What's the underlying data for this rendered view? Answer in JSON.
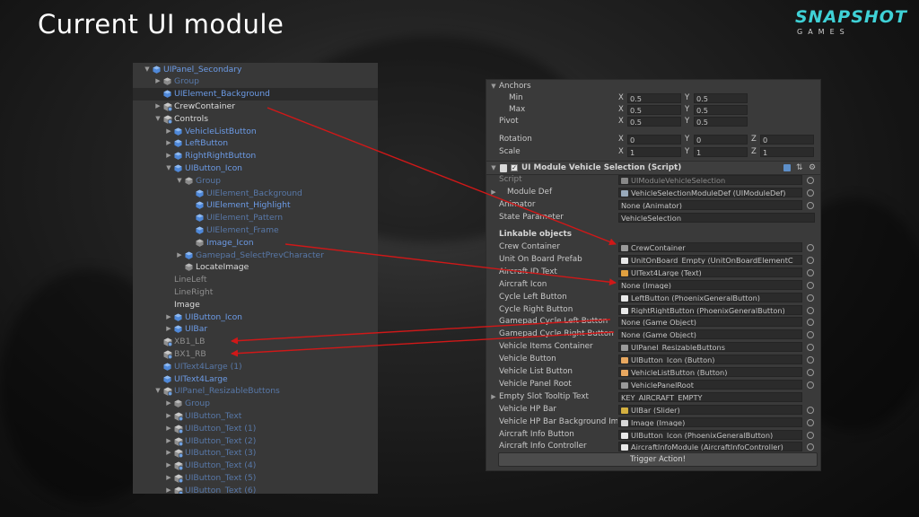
{
  "slide": {
    "title": "Current UI module",
    "logo": {
      "brand": "SNAPSHOT",
      "sub": "GAMES"
    }
  },
  "hierarchy": {
    "rows": [
      {
        "label": "UIPanel_Secondary",
        "indent": 0,
        "arrow": "open",
        "icon": "cube",
        "color": "blue"
      },
      {
        "label": "Group",
        "indent": 1,
        "arrow": "closed",
        "icon": "cube-grey",
        "color": "dimblue"
      },
      {
        "label": "UIElement_Background",
        "indent": 1,
        "arrow": "none",
        "icon": "cube",
        "color": "blue",
        "selected": true
      },
      {
        "label": "CrewContainer",
        "indent": 1,
        "arrow": "closed",
        "icon": "cube-gear",
        "color": "white"
      },
      {
        "label": "Controls",
        "indent": 1,
        "arrow": "open",
        "icon": "cube-gear",
        "color": "white"
      },
      {
        "label": "VehicleListButton",
        "indent": 2,
        "arrow": "closed",
        "icon": "cube",
        "color": "blue"
      },
      {
        "label": "LeftButton",
        "indent": 2,
        "arrow": "closed",
        "icon": "cube",
        "color": "blue"
      },
      {
        "label": "RightRightButton",
        "indent": 2,
        "arrow": "closed",
        "icon": "cube",
        "color": "blue"
      },
      {
        "label": "UIButton_Icon",
        "indent": 2,
        "arrow": "open",
        "icon": "cube",
        "color": "blue"
      },
      {
        "label": "Group",
        "indent": 3,
        "arrow": "open",
        "icon": "cube-grey",
        "color": "dimblue"
      },
      {
        "label": "UIElement_Background",
        "indent": 4,
        "arrow": "none",
        "icon": "cube",
        "color": "dimblue"
      },
      {
        "label": "UIElement_Highlight",
        "indent": 4,
        "arrow": "none",
        "icon": "cube",
        "color": "blue"
      },
      {
        "label": "UIElement_Pattern",
        "indent": 4,
        "arrow": "none",
        "icon": "cube",
        "color": "dimblue"
      },
      {
        "label": "UIElement_Frame",
        "indent": 4,
        "arrow": "none",
        "icon": "cube",
        "color": "dimblue"
      },
      {
        "label": "Image_Icon",
        "indent": 4,
        "arrow": "none",
        "icon": "cube-grey",
        "color": "blue"
      },
      {
        "label": "Gamepad_SelectPrevCharacter",
        "indent": 3,
        "arrow": "closed",
        "icon": "cube",
        "color": "dimblue"
      },
      {
        "label": "LocateImage",
        "indent": 3,
        "arrow": "none",
        "icon": "cube-grey",
        "color": "white"
      },
      {
        "label": "LineLeft",
        "indent": 2,
        "arrow": "none",
        "icon": "none",
        "color": "grey"
      },
      {
        "label": "LineRight",
        "indent": 2,
        "arrow": "none",
        "icon": "none",
        "color": "grey"
      },
      {
        "label": "Image",
        "indent": 2,
        "arrow": "none",
        "icon": "none",
        "color": "white"
      },
      {
        "label": "UIButton_Icon",
        "indent": 2,
        "arrow": "closed",
        "icon": "cube",
        "color": "blue"
      },
      {
        "label": "UIBar",
        "indent": 2,
        "arrow": "closed",
        "icon": "cube",
        "color": "blue"
      },
      {
        "label": "XB1_LB",
        "indent": 1,
        "arrow": "none",
        "icon": "cube-gear",
        "color": "grey"
      },
      {
        "label": "BX1_RB",
        "indent": 1,
        "arrow": "none",
        "icon": "cube-gear",
        "color": "grey"
      },
      {
        "label": "UIText4Large (1)",
        "indent": 1,
        "arrow": "none",
        "icon": "cube",
        "color": "dimblue"
      },
      {
        "label": "UIText4Large",
        "indent": 1,
        "arrow": "none",
        "icon": "cube",
        "color": "blue"
      },
      {
        "label": "UIPanel_ResizableButtons",
        "indent": 1,
        "arrow": "open",
        "icon": "cube-gear",
        "color": "dimblue"
      },
      {
        "label": "Group",
        "indent": 2,
        "arrow": "closed",
        "icon": "cube-grey",
        "color": "dimblue"
      },
      {
        "label": "UIButton_Text",
        "indent": 2,
        "arrow": "closed",
        "icon": "cube-gear",
        "color": "dimblue"
      },
      {
        "label": "UIButton_Text (1)",
        "indent": 2,
        "arrow": "closed",
        "icon": "cube-gear",
        "color": "dimblue"
      },
      {
        "label": "UIButton_Text (2)",
        "indent": 2,
        "arrow": "closed",
        "icon": "cube-gear",
        "color": "dimblue"
      },
      {
        "label": "UIButton_Text (3)",
        "indent": 2,
        "arrow": "closed",
        "icon": "cube-gear",
        "color": "dimblue"
      },
      {
        "label": "UIButton_Text (4)",
        "indent": 2,
        "arrow": "closed",
        "icon": "cube-gear",
        "color": "dimblue"
      },
      {
        "label": "UIButton_Text (5)",
        "indent": 2,
        "arrow": "closed",
        "icon": "cube-gear",
        "color": "dimblue"
      },
      {
        "label": "UIButton_Text (6)",
        "indent": 2,
        "arrow": "closed",
        "icon": "cube-gear",
        "color": "dimblue"
      }
    ]
  },
  "inspector": {
    "anchors_label": "Anchors",
    "min_label": "Min",
    "max_label": "Max",
    "pivot_label": "Pivot",
    "rotation_label": "Rotation",
    "scale_label": "Scale",
    "axis_x": "X",
    "axis_y": "Y",
    "axis_z": "Z",
    "min": {
      "x": "0.5",
      "y": "0.5"
    },
    "max": {
      "x": "0.5",
      "y": "0.5"
    },
    "pivot": {
      "x": "0.5",
      "y": "0.5"
    },
    "rotation": {
      "x": "0",
      "y": "0",
      "z": "0"
    },
    "scale": {
      "x": "1",
      "y": "1",
      "z": "1"
    },
    "component_title": "UI Module Vehicle Selection (Script)",
    "script_label": "Script",
    "script_value": "UIModuleVehicleSelection",
    "module_def_label": "Module Def",
    "module_def_value": "VehicleSelectionModuleDef (UIModuleDef)",
    "animator_label": "Animator",
    "animator_value": "None (Animator)",
    "state_param_label": "State Parameter",
    "state_param_value": "VehicleSelection",
    "linkable_label": "Linkable objects",
    "fields": [
      {
        "label": "Crew Container",
        "value": "CrewContainer",
        "icon": "transform"
      },
      {
        "label": "Unit On Board Prefab",
        "value": "UnitOnBoard_Empty (UnitOnBoardElementC",
        "icon": "script"
      },
      {
        "label": "Aircraft ID Text",
        "value": "UIText4Large (Text)",
        "icon": "text"
      },
      {
        "label": "Aircraft Icon",
        "value": "None (Image)",
        "icon": "none"
      },
      {
        "label": "Cycle Left Button",
        "value": "LeftButton (PhoenixGeneralButton)",
        "icon": "script"
      },
      {
        "label": "Cycle Right Button",
        "value": "RightRightButton (PhoenixGeneralButton)",
        "icon": "script"
      },
      {
        "label": "Gamepad Cycle Left Button",
        "value": "None (Game Object)",
        "icon": "none"
      },
      {
        "label": "Gamepad Cycle Right Button",
        "value": "None (Game Object)",
        "icon": "none"
      },
      {
        "label": "Vehicle Items Container",
        "value": "UIPanel_ResizableButtons",
        "icon": "transform"
      },
      {
        "label": "Vehicle Button",
        "value": "UIButton_Icon (Button)",
        "icon": "button"
      },
      {
        "label": "Vehicle List Button",
        "value": "VehicleListButton (Button)",
        "icon": "button"
      },
      {
        "label": "Vehicle Panel Root",
        "value": "VehiclePanelRoot",
        "icon": "transform"
      },
      {
        "label": "Empty Slot Tooltip Text",
        "value": "KEY_AIRCRAFT_EMPTY",
        "icon": "none",
        "foldout": true
      },
      {
        "label": "Vehicle HP Bar",
        "value": "UIBar (Slider)",
        "icon": "slider"
      },
      {
        "label": "Vehicle HP Bar Background Im",
        "value": "Image (Image)",
        "icon": "image"
      },
      {
        "label": "Aircraft Info Button",
        "value": "UIButton_Icon (PhoenixGeneralButton)",
        "icon": "script"
      },
      {
        "label": "Aircraft Info Controller",
        "value": "AircraftInfoModule (AircraftInfoController)",
        "icon": "script"
      }
    ],
    "trigger_label": "Trigger Action!"
  },
  "colors": {
    "accent_logo": "#3fd1d6",
    "hierarchy_blue": "#6c9be6",
    "arrow_red": "#d01818"
  }
}
